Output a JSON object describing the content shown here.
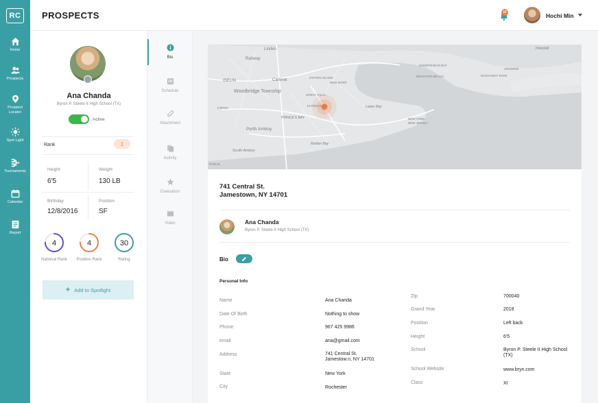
{
  "nav": {
    "logo": "RC",
    "items": [
      {
        "label": "Home",
        "icon": "home-icon"
      },
      {
        "label": "Prospects",
        "icon": "users-icon"
      },
      {
        "label": "Prospect Locator",
        "icon": "map-pin-icon"
      },
      {
        "label": "Spot Light",
        "icon": "spotlight-icon"
      },
      {
        "label": "Tournaments",
        "icon": "tournament-icon"
      },
      {
        "label": "Calendar",
        "icon": "calendar-icon"
      },
      {
        "label": "Report",
        "icon": "report-icon"
      }
    ]
  },
  "header": {
    "title": "PROSPECTS",
    "notification_count": "10",
    "user_name": "Hochi Min"
  },
  "profile": {
    "name": "Ana Chanda",
    "school": "Byron P. Steele II High School (TX)",
    "status": "Active",
    "rank_label": "Rank",
    "rank_value": "1",
    "height_label": "Height",
    "height_value": "6'5",
    "weight_label": "Weight",
    "weight_value": "130 LB",
    "birthday_label": "Birthday",
    "birthday_value": "12/8/2016",
    "position_label": "Position",
    "position_value": "SF",
    "rings": [
      {
        "value": "4",
        "label": "National Rank",
        "color": "#5b4fe0",
        "fraction": 0.75
      },
      {
        "value": "4",
        "label": "Position Rank",
        "color": "#f07d44",
        "fraction": 0.75
      },
      {
        "value": "30",
        "label": "Rating",
        "color": "#3a9fa5",
        "fraction": 1.0
      }
    ],
    "spotlight_button": "Add to Spotlight"
  },
  "tabs": [
    "Bio",
    "Schedule",
    "Attachment",
    "Activity",
    "Evaluation",
    "Video"
  ],
  "map": {
    "labels": [
      "Linden",
      "Rahway",
      "Inwood",
      "ISELIN",
      "Carteret",
      "STATEN ISLAND",
      "NEW DORP",
      "SHEEPSHEAD BAY",
      "ARVERNE",
      "ROCKAWAY PARK",
      "BRIGHTON BEACH",
      "Woodbridge Township",
      "GREAT KILLS",
      "FORDS",
      "ELTINGVILLE",
      "PRINCE'S BAY",
      "Perth Amboy",
      "South Amboy",
      "NEW YORK",
      "NEW JERSEY",
      "Raritan Bay",
      "Lower Bay",
      "PARLIN"
    ]
  },
  "address": {
    "line1": "741 Central St.",
    "line2": "Jamestown, NY 14701"
  },
  "bio": {
    "name": "Ana Chanda",
    "school": "Byron P. Steele II High School (TX)",
    "bio_label": "Bio",
    "personal_info_label": "Personal Info",
    "left_fields": [
      {
        "key": "Name",
        "value": "Ana Chanda"
      },
      {
        "key": "Date Of Birth",
        "value": "Nothing to show"
      },
      {
        "key": "Phone",
        "value": "967 425 9986"
      },
      {
        "key": "email",
        "value": "ana@gmail.com"
      },
      {
        "key": "Address",
        "value": "741 Central St.\nJamestow.n, NY 14701"
      },
      {
        "key": "State",
        "value": "New York"
      },
      {
        "key": "City",
        "value": "Rochester"
      }
    ],
    "right_fields": [
      {
        "key": "Zip",
        "value": "700040"
      },
      {
        "key": "Grand Year",
        "value": "2018"
      },
      {
        "key": "Position",
        "value": "Left back"
      },
      {
        "key": "Height",
        "value": "6'5"
      },
      {
        "key": "School",
        "value": "Byron P. Steele II High School (TX)"
      },
      {
        "key": "School Website",
        "value": "www.bryn.com"
      },
      {
        "key": "Class",
        "value": "XI"
      }
    ]
  }
}
